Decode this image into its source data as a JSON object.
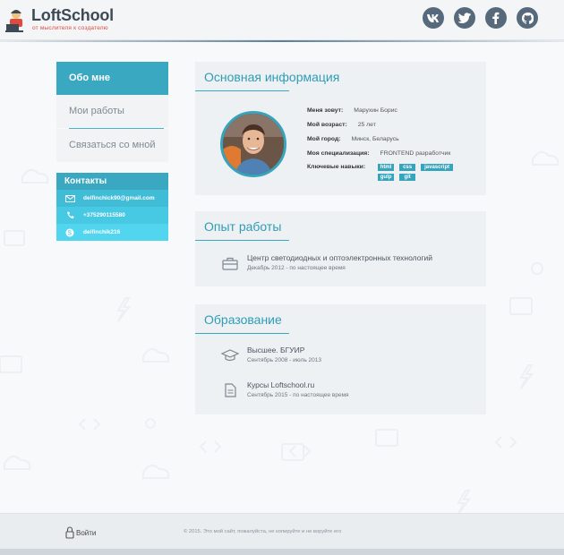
{
  "header": {
    "logo_title": "LoftSchool",
    "logo_subtitle": "от мыслителя к создателю",
    "socials": [
      {
        "name": "vk-icon",
        "label": "vk"
      },
      {
        "name": "twitter-icon",
        "label": "t"
      },
      {
        "name": "facebook-icon",
        "label": "f"
      },
      {
        "name": "github-icon",
        "label": "gh"
      }
    ]
  },
  "nav": {
    "items": [
      {
        "label": "Обо мне"
      },
      {
        "label": "Мои работы"
      },
      {
        "label": "Связаться со мной"
      }
    ]
  },
  "contacts": {
    "title": "Контакты",
    "email": "delfinchick90@gmail.com",
    "phone": "+375290115580",
    "skype": "delfinchik216"
  },
  "info": {
    "title": "Основная информация",
    "rows": [
      {
        "key": "Меня зовут:",
        "value": "Марухин Борис"
      },
      {
        "key": "Мой возраст:",
        "value": "25 лет"
      },
      {
        "key": "Мой город:",
        "value": "Минск, Беларусь"
      },
      {
        "key": "Моя специализация:",
        "value": "FRONTEND разработчик"
      }
    ],
    "skills_label": "Ключевые навыки:",
    "skills": [
      "html",
      "css",
      "javascript",
      "gulp",
      "git"
    ]
  },
  "experience": {
    "title": "Опыт работы",
    "entries": [
      {
        "title": "Центр светодиодных и оптоэлектронных технологий",
        "period": "Декабрь 2012 - по настоящее время"
      }
    ]
  },
  "education": {
    "title": "Образование",
    "entries": [
      {
        "title": "Высшее. БГУИР",
        "period": "Сентябрь 2008 - июль 2013"
      },
      {
        "title": "Курсы Loftschool.ru",
        "period": "Сентябрь 2015 - по настоящее время"
      }
    ]
  },
  "footer": {
    "login_label": "Войти",
    "copyright": "© 2015. Это мой сайт, пожалуйста, не копируйте и не воруйте его"
  },
  "colors": {
    "accent": "#3aa8c1",
    "social": "#566a7b",
    "logo_red": "#e34a3e"
  }
}
